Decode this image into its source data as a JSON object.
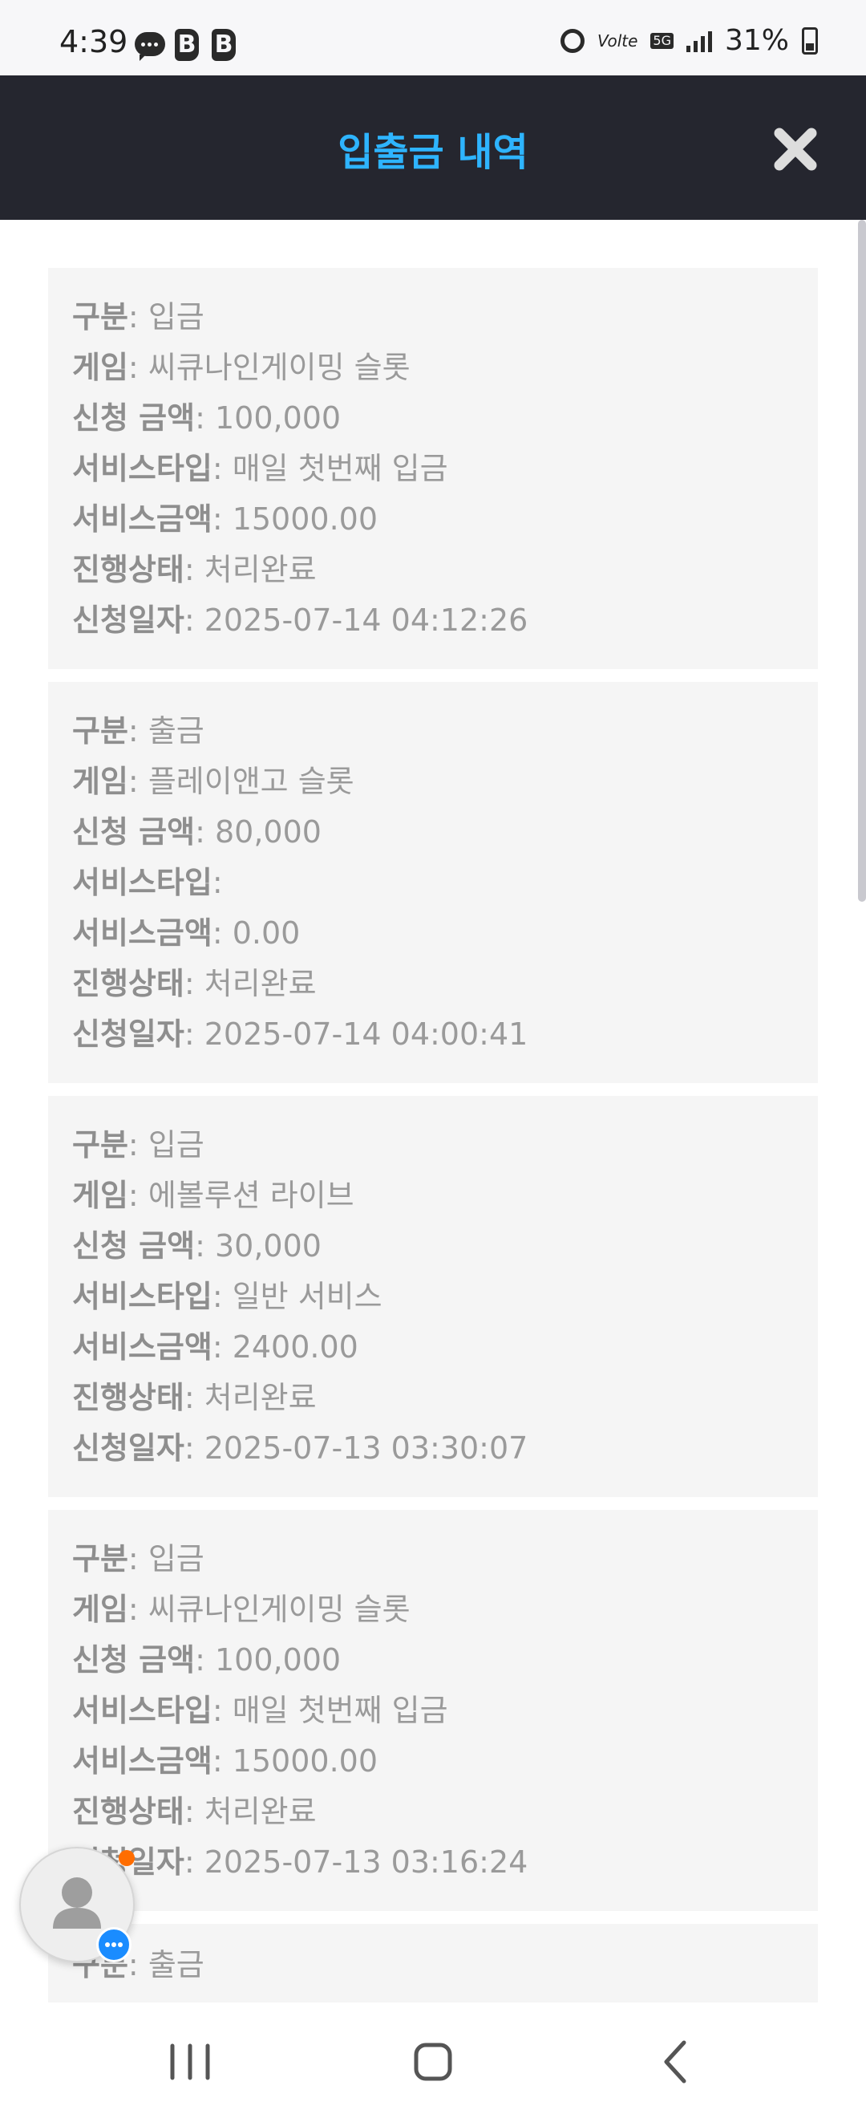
{
  "status_bar": {
    "time": "4:39",
    "notification_letters": [
      "B",
      "B"
    ],
    "network_volte": "Volte",
    "network_5g": "5G",
    "battery": "31%"
  },
  "header": {
    "title": "입출금 내역",
    "close_icon": "close-icon",
    "background": "#25262f",
    "title_color": "#2eb4ff"
  },
  "records": [
    {
      "type_label": "구분",
      "type": "입금",
      "game_label": "게임",
      "game": "씨큐나인게이밍 슬롯",
      "amount_label": "신청 금액",
      "amount": "100,000",
      "service_type_label": "서비스타입",
      "service_type": "매일 첫번째 입금",
      "service_amount_label": "서비스금액",
      "service_amount": "15000.00",
      "status_label": "진행상태",
      "status": "처리완료",
      "date_label": "신청일자",
      "date": "2025-07-14 04:12:26"
    },
    {
      "type_label": "구분",
      "type": "출금",
      "game_label": "게임",
      "game": "플레이앤고 슬롯",
      "amount_label": "신청 금액",
      "amount": "80,000",
      "service_type_label": "서비스타입",
      "service_type": "",
      "service_amount_label": "서비스금액",
      "service_amount": "0.00",
      "status_label": "진행상태",
      "status": "처리완료",
      "date_label": "신청일자",
      "date": "2025-07-14 04:00:41"
    },
    {
      "type_label": "구분",
      "type": "입금",
      "game_label": "게임",
      "game": "에볼루션 라이브",
      "amount_label": "신청 금액",
      "amount": "30,000",
      "service_type_label": "서비스타입",
      "service_type": "일반 서비스",
      "service_amount_label": "서비스금액",
      "service_amount": "2400.00",
      "status_label": "진행상태",
      "status": "처리완료",
      "date_label": "신청일자",
      "date": "2025-07-13 03:30:07"
    },
    {
      "type_label": "구분",
      "type": "입금",
      "game_label": "게임",
      "game": "씨큐나인게이밍 슬롯",
      "amount_label": "신청 금액",
      "amount": "100,000",
      "service_type_label": "서비스타입",
      "service_type": "매일 첫번째 입금",
      "service_amount_label": "서비스금액",
      "service_amount": "15000.00",
      "status_label": "진행상태",
      "status": "처리완료",
      "date_label": "신청일자",
      "date": "2025-07-13 03:16:24"
    },
    {
      "type_label": "구분",
      "type": "출금"
    }
  ],
  "floating_button": {
    "icon": "avatar-icon",
    "badge_icon": "chat-bubble-icon"
  },
  "nav_bar": {
    "recents": "recents-icon",
    "home": "home-icon",
    "back": "back-icon"
  }
}
